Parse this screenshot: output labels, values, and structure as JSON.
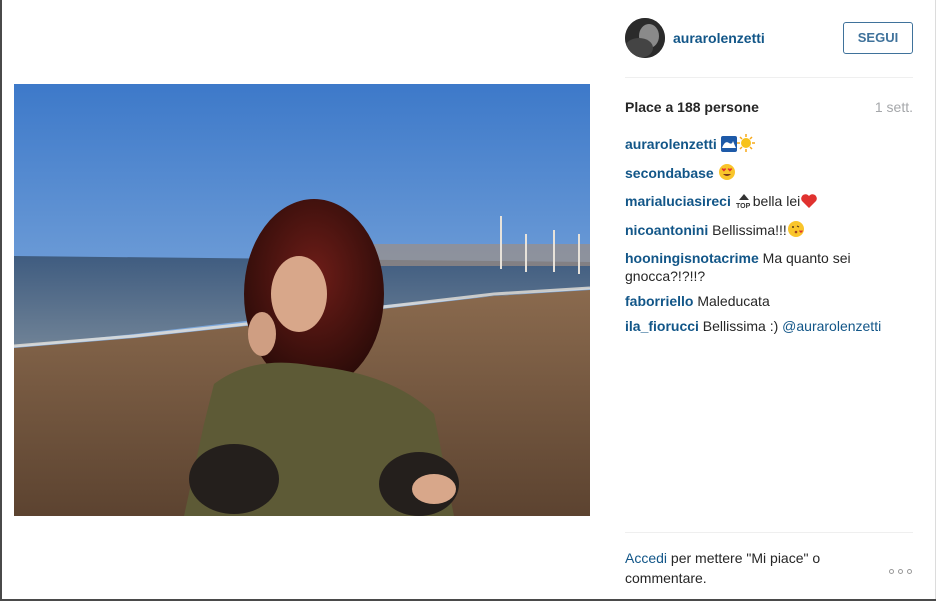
{
  "post": {
    "username": "aurarolenzetti",
    "follow_label": "SEGUI",
    "likes_text": "Place a 188 persone",
    "time_text": "1 sett.",
    "photo_alt": "photo"
  },
  "comments": [
    {
      "user": "aurarolenzetti",
      "text": " ",
      "emojis": [
        "wave-emoji",
        "sun-emoji"
      ]
    },
    {
      "user": "secondabase",
      "text": " ",
      "emojis": [
        "heart-eyes-emoji"
      ]
    },
    {
      "user": "marialuciasireci",
      "text_pre": " ",
      "text": "bella lei",
      "emojis": [
        "top-emoji",
        "red-heart-emoji"
      ]
    },
    {
      "user": "nicoantonini",
      "text": " Bellissima!!!",
      "emojis": [
        "kiss-face-emoji"
      ]
    },
    {
      "user": "hooningisnotacrime",
      "text": " Ma quanto sei gnocca?!?!!?"
    },
    {
      "user": "faborriello",
      "text": " Maleducata"
    },
    {
      "user": "ila_fiorucci",
      "text": " Bellissima :) ",
      "mention": "@aurarolenzetti"
    }
  ],
  "footer": {
    "login_label": "Accedi",
    "rest": " per mettere \"Mi piace\" o commentare."
  },
  "colors": {
    "link": "#125688",
    "follow": "#3f729b",
    "muted": "#a5a7aa"
  },
  "icons": {
    "more": "ellipsis-icon"
  }
}
